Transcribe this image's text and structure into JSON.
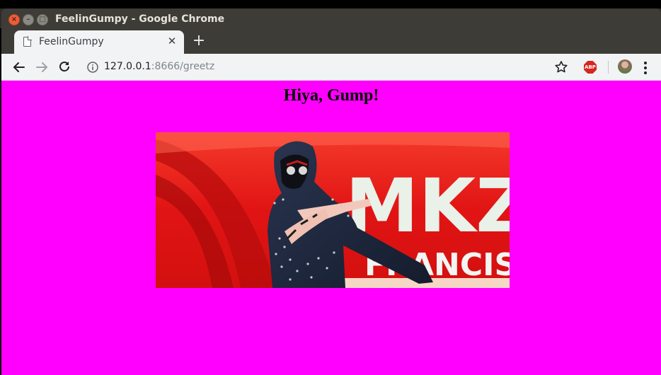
{
  "window": {
    "title": "FeelinGumpy - Google Chrome"
  },
  "tab": {
    "label": "FeelinGumpy",
    "close": "✕",
    "new_tab": "+"
  },
  "address_bar": {
    "host": "127.0.0.1",
    "rest": ":8666/greetz"
  },
  "extensions": {
    "adblock_label": "ABP"
  },
  "page": {
    "background": "#ff00ff",
    "heading": "Hiya, Gump!",
    "image": {
      "background_text_top": "MKZ",
      "background_text_bottom": "FRANCISCO"
    }
  }
}
